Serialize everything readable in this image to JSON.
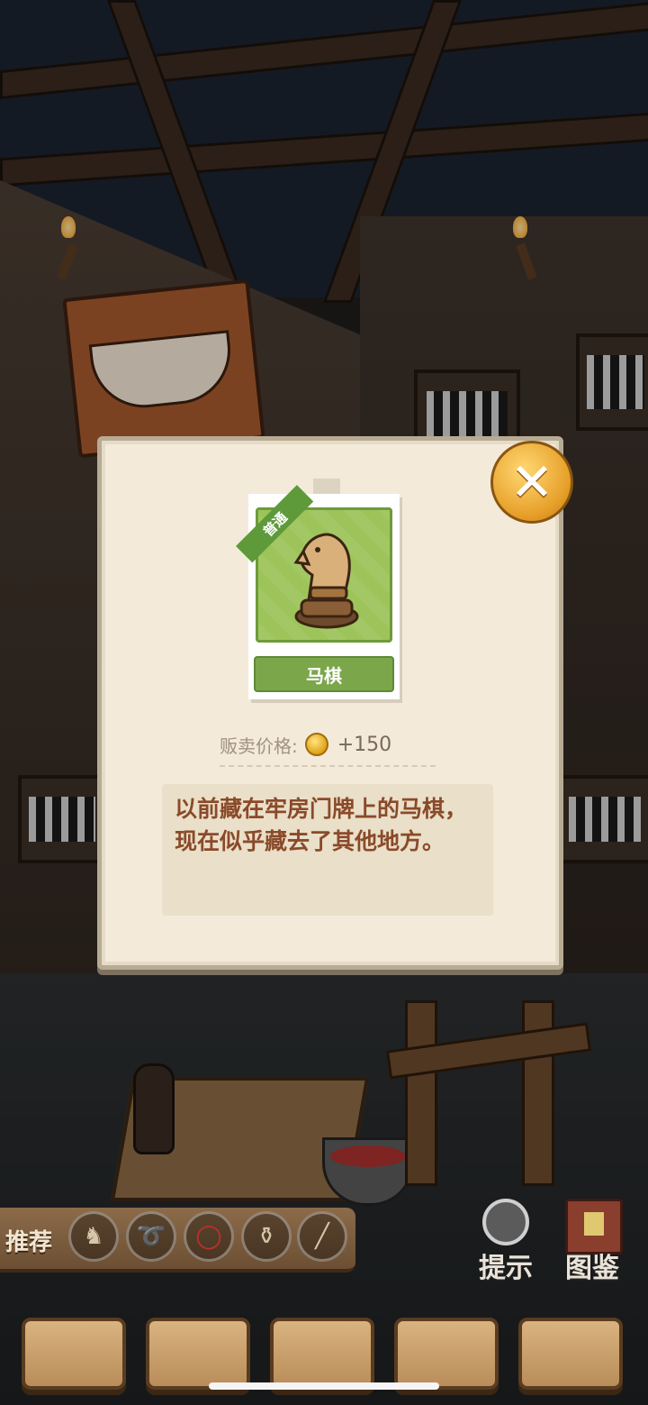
{
  "item": {
    "rarity": "普通",
    "name": "马棋",
    "price_label": "贩卖价格:",
    "price_value": "+150",
    "description": "以前藏在牢房门牌上的马棋，现在似乎藏去了其他地方。"
  },
  "close_button": {
    "glyph": "✕"
  },
  "recommend": {
    "label": "推荐",
    "slots": [
      {
        "icon": "knight-icon",
        "glyph": "♞"
      },
      {
        "icon": "rope-icon",
        "glyph": "➰"
      },
      {
        "icon": "ring-icon",
        "glyph": "◯"
      },
      {
        "icon": "lantern-icon",
        "glyph": "⚱"
      },
      {
        "icon": "stick-icon",
        "glyph": "╱"
      }
    ]
  },
  "actions": {
    "hint": "提示",
    "catalog": "图鉴"
  },
  "colors": {
    "card_green": "#9dc45a",
    "name_green": "#7ba64a",
    "desc_text": "#8a4a2a",
    "close_gold": "#e7a02a"
  }
}
